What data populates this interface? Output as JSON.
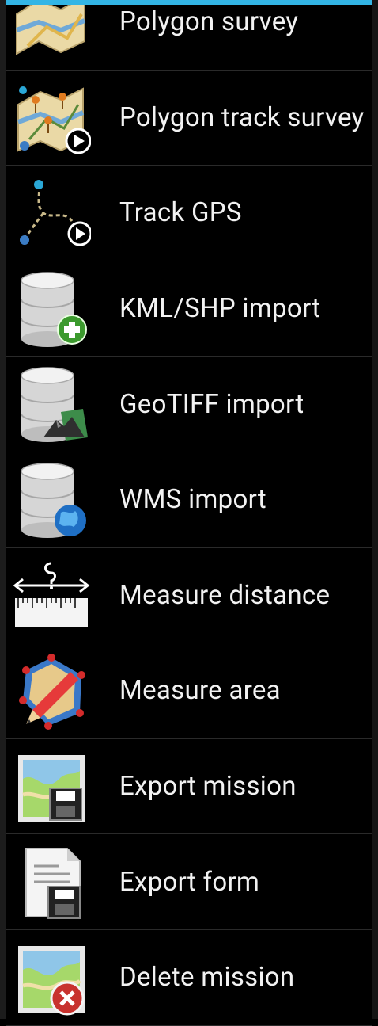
{
  "menu": {
    "items": [
      {
        "label": "Polygon survey",
        "icon": "polygon-survey-icon"
      },
      {
        "label": "Polygon track survey",
        "icon": "polygon-track-survey-icon"
      },
      {
        "label": "Track GPS",
        "icon": "track-gps-icon"
      },
      {
        "label": "KML/SHP import",
        "icon": "database-add-icon"
      },
      {
        "label": "GeoTIFF import",
        "icon": "database-image-icon"
      },
      {
        "label": "WMS import",
        "icon": "database-globe-icon"
      },
      {
        "label": "Measure distance",
        "icon": "ruler-icon"
      },
      {
        "label": "Measure area",
        "icon": "area-pencil-icon"
      },
      {
        "label": "Export mission",
        "icon": "map-save-icon"
      },
      {
        "label": "Export form",
        "icon": "document-save-icon"
      },
      {
        "label": "Delete mission",
        "icon": "map-delete-icon"
      }
    ]
  },
  "colors": {
    "background": "#000000",
    "accent": "#33b5e5",
    "text": "#f2f2f2",
    "divider": "#2a2a2a"
  }
}
